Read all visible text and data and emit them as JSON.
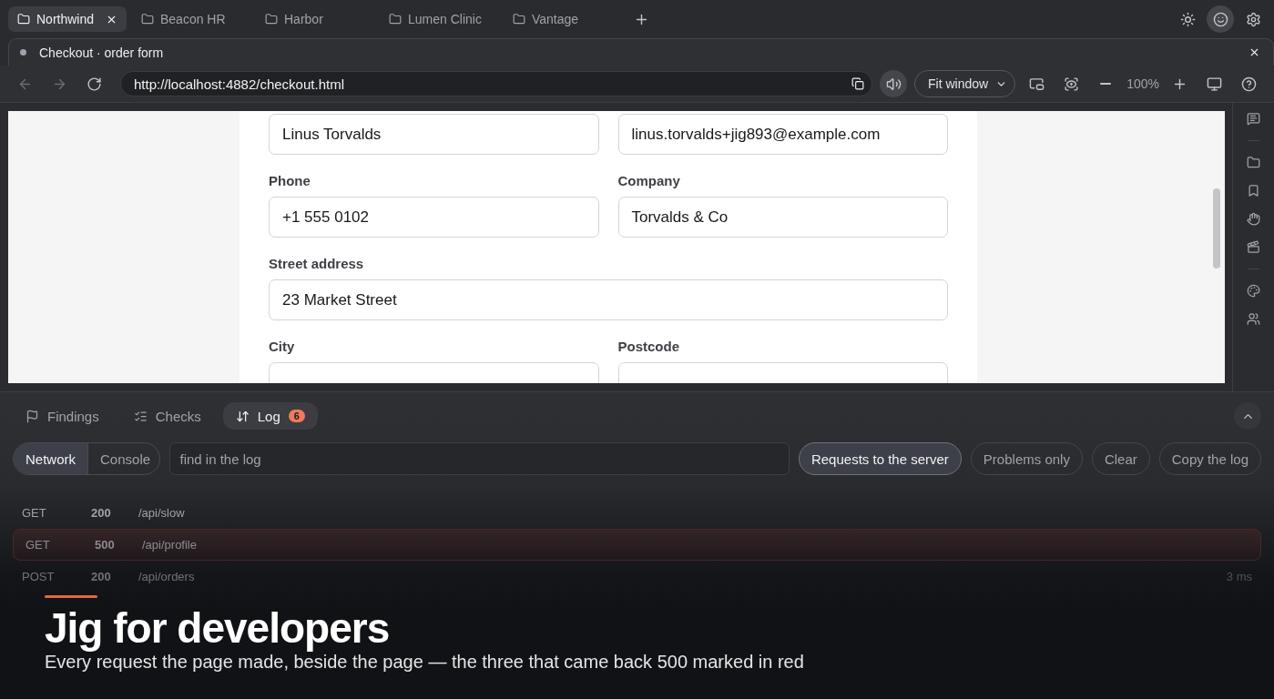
{
  "workspace_tabs": [
    {
      "label": "Northwind",
      "selected": true
    },
    {
      "label": "Beacon HR",
      "selected": false
    },
    {
      "label": "Harbor",
      "selected": false
    },
    {
      "label": "Lumen Clinic",
      "selected": false
    },
    {
      "label": "Vantage",
      "selected": false
    }
  ],
  "page_tab": {
    "title": "Checkout · order form"
  },
  "address": {
    "value": "http://localhost:4882/checkout.html"
  },
  "view": {
    "fit": "Fit window",
    "zoom": "100%"
  },
  "form": {
    "fields": [
      {
        "kind": "half",
        "value": "Linus Torvalds"
      },
      {
        "kind": "half",
        "value": "linus.torvalds+jig893@example.com"
      },
      {
        "kind": "half",
        "label": "Phone",
        "value": "+1 555 0102"
      },
      {
        "kind": "half",
        "label": "Company",
        "value": "Torvalds & Co"
      },
      {
        "kind": "full",
        "label": "Street address",
        "value": "23 Market Street"
      },
      {
        "kind": "half",
        "label": "City"
      },
      {
        "kind": "half",
        "label": "Postcode"
      }
    ]
  },
  "panel": {
    "tabs": [
      {
        "label": "Findings",
        "selected": false
      },
      {
        "label": "Checks",
        "selected": false
      },
      {
        "label": "Log",
        "selected": true,
        "badge": "6"
      }
    ],
    "views": [
      {
        "label": "Network",
        "selected": true
      },
      {
        "label": "Console",
        "selected": false
      }
    ],
    "search": {
      "placeholder": "find in the log"
    },
    "filters": [
      {
        "label": "Requests to the server",
        "selected": true
      },
      {
        "label": "Problems only",
        "selected": false
      }
    ],
    "buttons": [
      "Clear",
      "Copy the log"
    ],
    "requests": [
      {
        "method": "GET",
        "status": "200",
        "path": "/api/slow",
        "error": false
      },
      {
        "method": "GET",
        "status": "500",
        "path": "/api/profile",
        "error": true
      },
      {
        "method": "POST",
        "status": "200",
        "path": "/api/orders",
        "duration": "3 ms",
        "error": false
      }
    ]
  },
  "caption": {
    "title": "Jig for developers",
    "text": "Every request the page made, beside the page — the three that came back 500 marked in red"
  }
}
